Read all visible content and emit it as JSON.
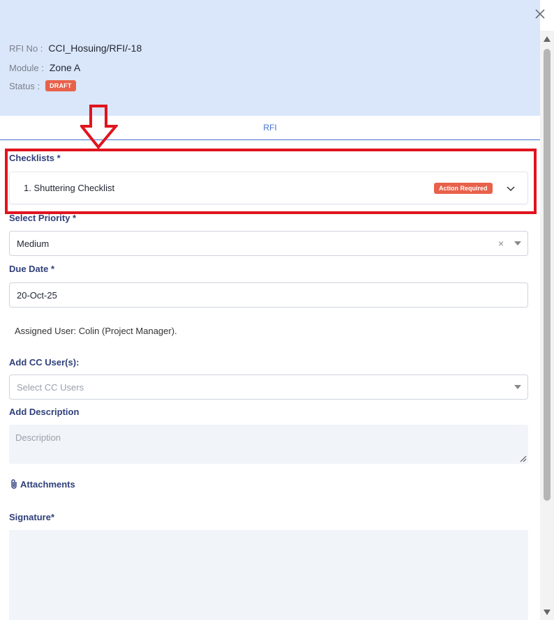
{
  "header": {
    "rfi_no_label": "RFI No :",
    "rfi_no_value": "CCI_Hosuing/RFI/-18",
    "module_label": "Module :",
    "module_value": "Zone A",
    "status_label": "Status :",
    "status_value": "DRAFT"
  },
  "tabs": [
    {
      "label": "RFI"
    }
  ],
  "checklists": {
    "label": "Checklists *",
    "items": [
      {
        "title": "1. Shuttering Checklist",
        "badge": "Action Required"
      }
    ]
  },
  "priority": {
    "label": "Select Priority *",
    "value": "Medium",
    "clear_glyph": "×"
  },
  "due_date": {
    "label": "Due Date *",
    "value": "20-Oct-25"
  },
  "assigned_user": "Assigned User: Colin (Project Manager).",
  "cc_users": {
    "label": "Add CC User(s):",
    "placeholder": "Select CC Users"
  },
  "description": {
    "label": "Add Description",
    "placeholder": "Description"
  },
  "attachments": {
    "label": "Attachments"
  },
  "signature": {
    "label": "Signature*"
  },
  "colors": {
    "header_bg": "#dae6f9",
    "accent_blue": "#3f6fcb",
    "badge_red": "#e8614a",
    "highlight_red": "#e0141e"
  },
  "icons": [
    "close-icon",
    "chevron-down-icon",
    "caret-down-icon",
    "paperclip-icon",
    "arrow-down-annotation",
    "scroll-up-icon",
    "scroll-down-icon",
    "resize-grip-icon"
  ]
}
